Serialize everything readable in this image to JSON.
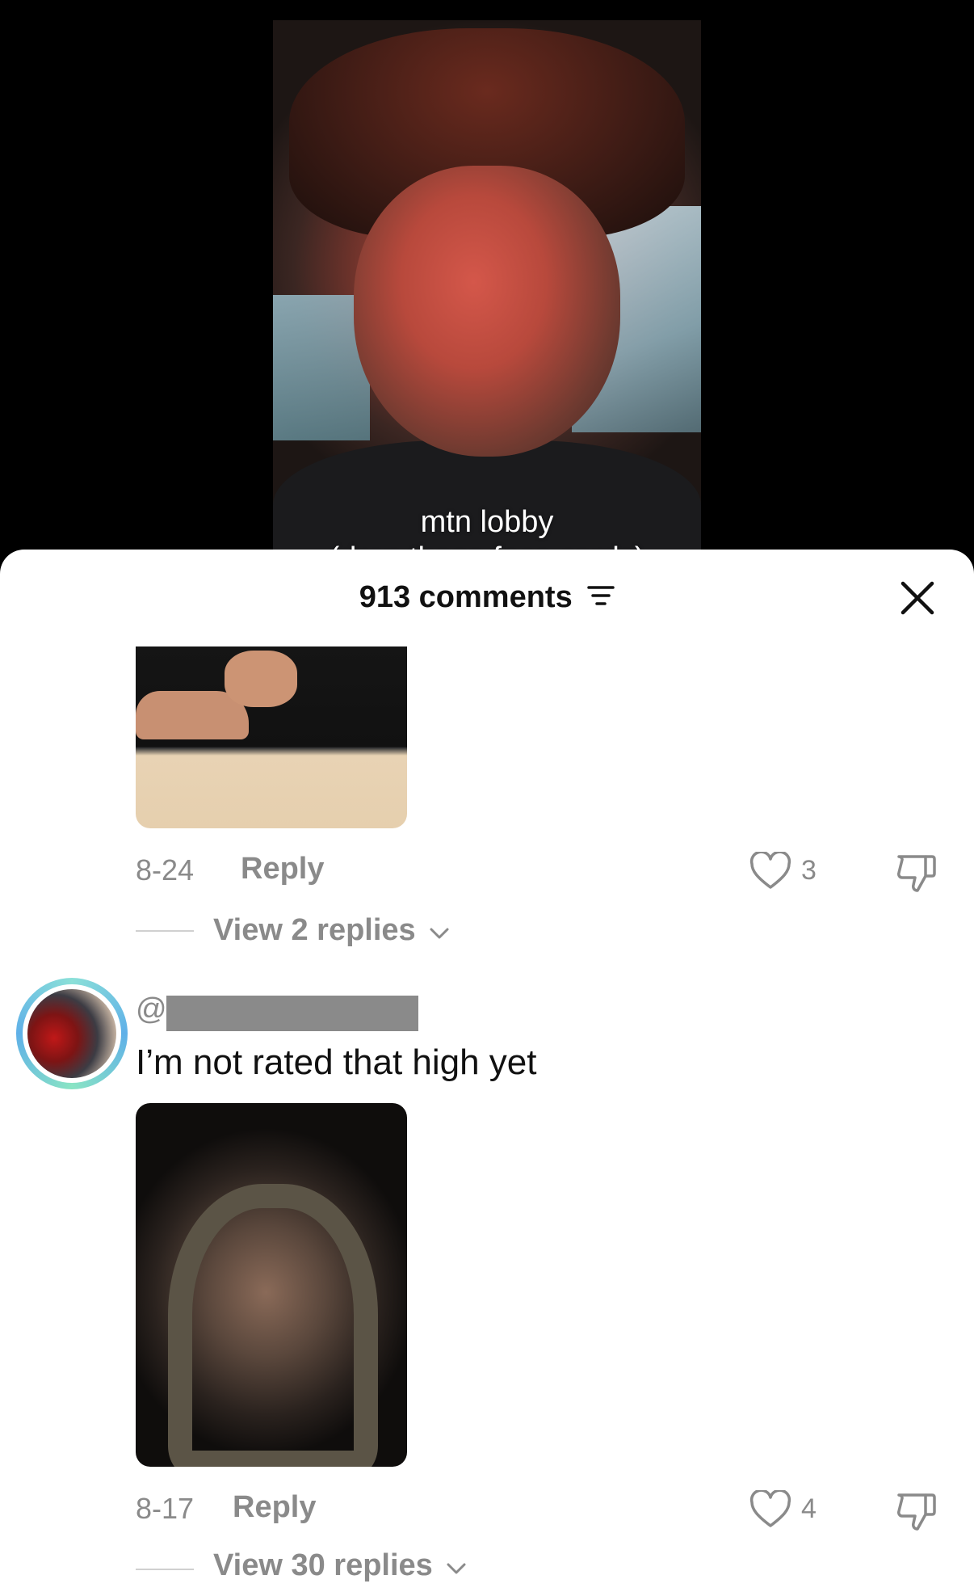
{
  "video": {
    "caption_line1": "mtn lobby",
    "caption_line2": "(drop those face cards)"
  },
  "comments_sheet": {
    "title": "913 comments",
    "filter_icon": "filter-icon",
    "close_icon": "close-icon"
  },
  "comments": [
    {
      "date": "8-24",
      "reply_label": "Reply",
      "likes": "3",
      "view_replies": "View 2 replies"
    },
    {
      "username_prefix": "@",
      "text": "I’m not rated that high yet",
      "date": "8-17",
      "reply_label": "Reply",
      "likes": "4",
      "view_replies": "View 30 replies"
    }
  ],
  "colors": {
    "muted": "#8a8a8a",
    "text": "#111111",
    "avatar_ring": "#5fb0e8"
  }
}
